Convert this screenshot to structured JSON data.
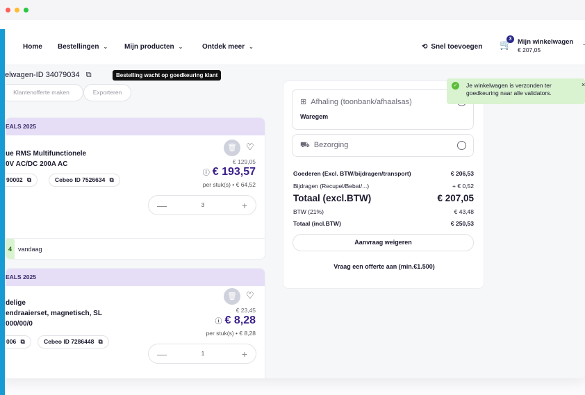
{
  "nav": {
    "home": "Home",
    "orders": "Bestellingen",
    "my_products": "Mijn producten",
    "discover": "Ontdek meer",
    "quick_add": "Snel toevoegen",
    "cart_label": "Mijn winkelwagen",
    "cart_total": "€ 207,05",
    "cart_count": "3"
  },
  "header": {
    "cart_id": "elwagen-ID 34079034",
    "status": "Bestelling wacht op goedkeuring klant",
    "btn_quote": "Klantenofferte maken",
    "btn_export": "Exporteren"
  },
  "items": [
    {
      "group": "EALS 2025",
      "name_line1": "ue RMS Multifunctionele",
      "name_line2": "0V AC/DC 200A AC",
      "code": "90002",
      "cebeo_id": "Cebeo ID 7526634",
      "old_price": "€ 129,05",
      "price": "€ 193,57",
      "unit": "per stuk(s) • € 64,52",
      "qty": "3",
      "stock_count": "4",
      "stock_text": "vandaag"
    },
    {
      "group": "EALS 2025",
      "name_line1": "delige",
      "name_line2": "endraaierset, magnetisch, SL",
      "name_line3": "000/00/0",
      "code": "006",
      "cebeo_id": "Cebeo ID 7286448",
      "old_price": "€ 23,45",
      "price": "€ 8,28",
      "unit": "per stuk(s) • € 8,28",
      "qty": "1"
    }
  ],
  "delivery": {
    "pickup_label": "Afhaling (toonbank/afhaalsas)",
    "pickup_location": "Waregem",
    "delivery_label": "Bezorging"
  },
  "summary": {
    "goods_label": "Goederen (Excl. BTW/bijdragen/transport)",
    "goods_value": "€ 206,53",
    "contrib_label": "Bijdragen (Recupel/Bebat/...)",
    "contrib_value": "+ € 0,52",
    "total_excl_label": "Totaal (excl.BTW)",
    "total_excl_value": "€ 207,05",
    "vat_label": "BTW (21%)",
    "vat_value": "€ 43,48",
    "total_incl_label": "Totaal (incl.BTW)",
    "total_incl_value": "€ 250,53",
    "reject_btn": "Aanvraag weigeren",
    "quote_link": "Vraag een offerte aan (min.€1.500)"
  },
  "toast": {
    "message": "Je winkelwagen is verzonden ter goedkeuring naar alle validators."
  },
  "colors": {
    "accent": "#169bd5",
    "price": "#3a1f8a",
    "group_header": "#e6def7",
    "toast_bg": "#d9f2cf"
  }
}
